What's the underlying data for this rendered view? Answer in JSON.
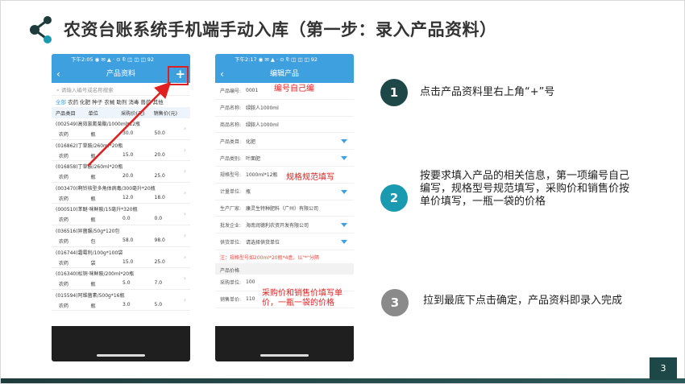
{
  "title": "农资台账系统手机端手动入库（第一步：录入产品资料）",
  "phone1": {
    "status": "下午2:05 ◉ ✉ ▲ · ⊙ ⅊ ◫ ◫ ◫ 92",
    "app_title": "产品资料",
    "back": "‹",
    "plus": "+",
    "search_placeholder": "请输入编号或名称搜索",
    "categories": [
      "全部",
      "农药",
      "化肥",
      "种子",
      "农械",
      "助剂",
      "消毒",
      "兽药",
      "其他"
    ],
    "headers": [
      "产品类目",
      "单位",
      "采购价(元)",
      "销售价(元)"
    ],
    "products": [
      {
        "name": "(002549)高效氯氰菊酯/1000ml*12瓶",
        "cat": "农药",
        "unit": "瓶",
        "buy": "30.0",
        "sell": "50.0"
      },
      {
        "name": "(016862)丁草胺/260ml*20瓶",
        "cat": "农药",
        "unit": "瓶",
        "buy": "15.0",
        "sell": "20.0"
      },
      {
        "name": "(016858)丁草胺/260ml*20瓶",
        "cat": "农药",
        "unit": "瓶",
        "buy": "20.0",
        "sell": "25.0"
      },
      {
        "name": "(003470)啊铃核型多角体病毒/300毫升*20瓶",
        "cat": "农药",
        "unit": "瓶",
        "buy": "12.0",
        "sell": "18.0"
      },
      {
        "name": "(000510)苯醚·咪鲜胺/15毫升*320瓶",
        "cat": "农药",
        "unit": "瓶",
        "buy": "0.0",
        "sell": "0.0"
      },
      {
        "name": "(036516)异菌脲/50g*120包",
        "cat": "农药",
        "unit": "包",
        "buy": "58.0",
        "sell": "98.0"
      },
      {
        "name": "(016744)霜霉利/100g*100袋",
        "cat": "农药",
        "unit": "袋",
        "buy": "15.0",
        "sell": "25.0"
      },
      {
        "name": "(016340)松铜·咪鲜胺/200ml*20瓶",
        "cat": "农药",
        "unit": "瓶",
        "buy": "5.0",
        "sell": "7.0"
      },
      {
        "name": "(015594)阿维菌素/500g*16瓶",
        "cat": "农药",
        "unit": "瓶",
        "buy": "3.0",
        "sell": "5.0"
      }
    ]
  },
  "phone2": {
    "status": "下午2:17 ◉ ✉ ▲ · ⊙ ⅊ ◫ ◫ ◫ 92",
    "app_title": "编辑产品",
    "back": "‹",
    "fields": [
      {
        "label": "产品编号:",
        "value": "0001",
        "dropdown": false
      },
      {
        "label": "产品名称:",
        "value": "绿脓人1000ml",
        "dropdown": false
      },
      {
        "label": "商品名称:",
        "value": "绿脓人1000ml",
        "dropdown": false
      },
      {
        "label": "产品类目:",
        "value": "化肥",
        "dropdown": true
      },
      {
        "label": "产品类别:",
        "value": "叶面肥",
        "dropdown": true
      },
      {
        "label": "规格型号:",
        "value": "1000ml*12瓶",
        "dropdown": false
      },
      {
        "label": "计量单位:",
        "value": "瓶",
        "dropdown": true
      },
      {
        "label": "生产厂家:",
        "value": "康灵生特种肥料（广州）有限公司",
        "dropdown": false
      },
      {
        "label": "批发企业:",
        "value": "海南润德利农资开发有限公司",
        "dropdown": true
      },
      {
        "label": "供货单位:",
        "value": "请选择供货单位",
        "dropdown": true
      }
    ],
    "note": "注：规格型号如200ml*20瓶*4盒，以\"*\"分隔",
    "section": "产品价格",
    "price_fields": [
      {
        "label": "采购单位:",
        "value": "100"
      },
      {
        "label": "销售单价:",
        "value": "110"
      }
    ]
  },
  "annotations": {
    "code": "编号自己编",
    "spec": "规格规范填写",
    "price": "采购价和销售价填写单价，一瓶一袋的价格"
  },
  "steps": [
    {
      "num": "1",
      "text": "点击产品资料里右上角“+”号",
      "color": "#1e4848"
    },
    {
      "num": "2",
      "text": "按要求填入产品的相关信息，第一项编号自己编写，规格型号规范填写，采购价和销售价按单价填写，一瓶一袋的价格",
      "color": "#1a9ab0"
    },
    {
      "num": "3",
      "text": "拉到最底下点击确定，产品资料即录入完成",
      "color": "#8a8a8a"
    }
  ],
  "page_number": "3"
}
